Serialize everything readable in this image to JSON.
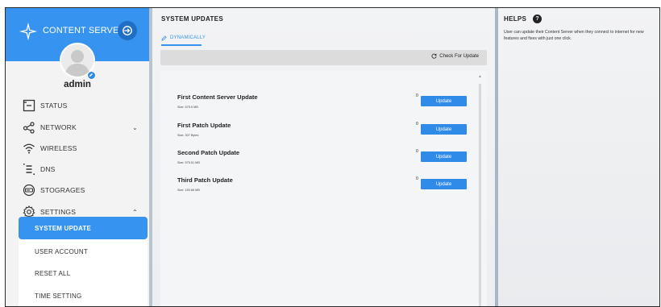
{
  "sidebar": {
    "brand_title": "CONTENT SERVER",
    "username": "admin",
    "nav": [
      {
        "label": "STATUS",
        "icon": "status-icon"
      },
      {
        "label": "NETWORK",
        "icon": "network-icon",
        "chevron": "⌄"
      },
      {
        "label": "WIRELESS",
        "icon": "wifi-icon"
      },
      {
        "label": "DNS",
        "icon": "dns-icon"
      },
      {
        "label": "STOGRAGES",
        "icon": "storage-icon"
      },
      {
        "label": "SETTINGS",
        "icon": "gear-icon",
        "chevron": "⌃"
      }
    ],
    "settings_submenu": [
      {
        "label": "SYSTEM UPDATE",
        "active": true
      },
      {
        "label": "USER ACCOUNT",
        "active": false
      },
      {
        "label": "RESET ALL",
        "active": false
      },
      {
        "label": "TIME SETTING",
        "active": false
      }
    ]
  },
  "main": {
    "title": "SYSTEM UPDATES",
    "tab_label": "DYNAMICALLY",
    "check_button_label": "Check For Update",
    "updates": [
      {
        "name": "First Content Server Update",
        "size": "Size: 575.5 MB",
        "progress": "0",
        "button_label": "Update"
      },
      {
        "name": "First Patch Update",
        "size": "Size: 307 Bytes",
        "progress": "0",
        "button_label": "Update"
      },
      {
        "name": "Second Patch Update",
        "size": "Size: 575.51 MB",
        "progress": "0",
        "button_label": "Update"
      },
      {
        "name": "Third Patch Update",
        "size": "Size: 150.66 MB",
        "progress": "0",
        "button_label": "Update"
      }
    ]
  },
  "help": {
    "title": "HELPS",
    "icon_glyph": "?",
    "text": "User can update their Content Server when they connect to internet for new features and fixes with just one click."
  },
  "colors": {
    "accent": "#3793f0",
    "button": "#2f8ae8"
  }
}
